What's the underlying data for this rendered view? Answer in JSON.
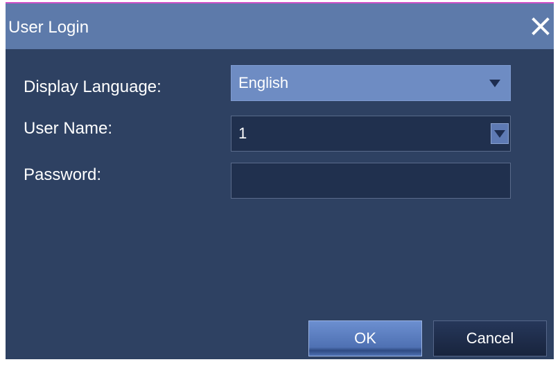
{
  "window": {
    "title": "User Login",
    "close_icon": "close-icon"
  },
  "form": {
    "language_label": "Display Language:",
    "language_value": "English",
    "username_label": "User Name:",
    "username_value": "1",
    "password_label": "Password:",
    "password_value": ""
  },
  "buttons": {
    "ok_label": "OK",
    "cancel_label": "Cancel"
  },
  "colors": {
    "dialog_bg": "#2e4162",
    "titlebar_bg": "#5d7aaa",
    "accent": "#6e8cc3",
    "border_top": "#d050c8"
  }
}
